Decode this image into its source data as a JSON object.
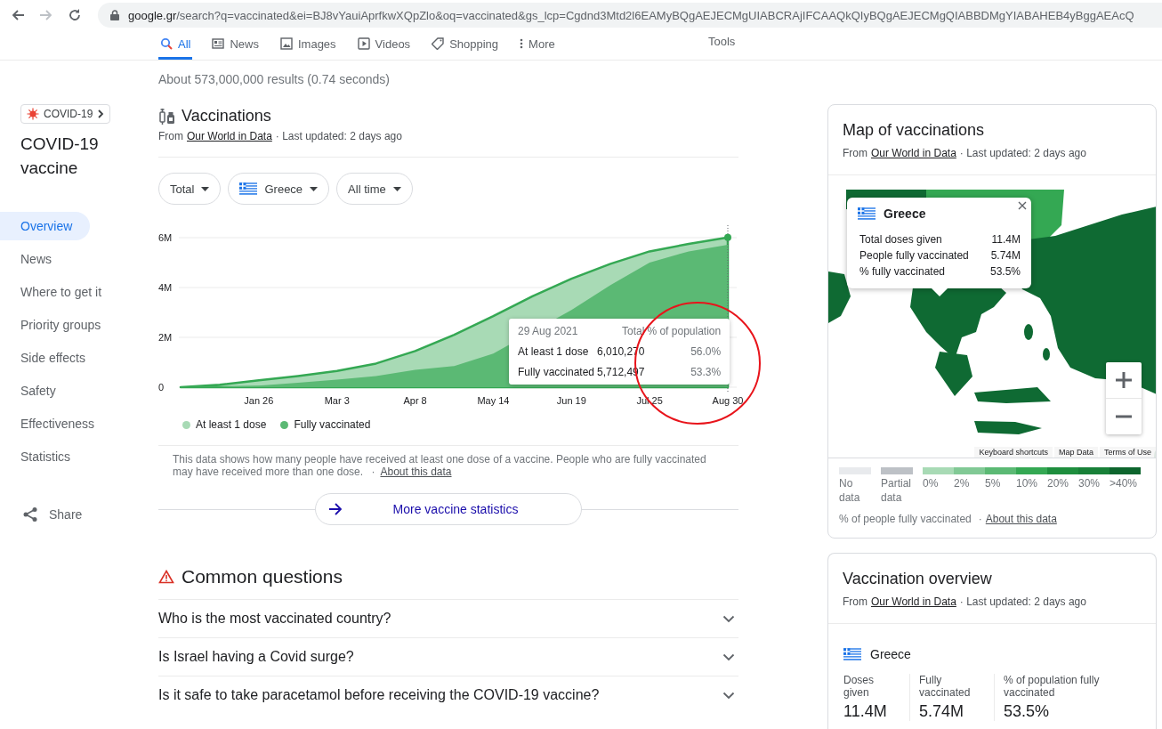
{
  "browser": {
    "nav_buttons": [
      {
        "kind": "back",
        "disabled": false
      },
      {
        "kind": "forward",
        "disabled": true
      },
      {
        "kind": "reload",
        "disabled": false
      }
    ],
    "url_host": "google.gr",
    "url_path": "/search?q=vaccinated&ei=BJ8vYauiAprfkwXQpZlo&oq=vaccinated&gs_lcp=Cgdnd3Mtd2l6EAMyBQgAEJECMgUIABCRAjIFCAAQkQIyBQgAEJECMgQIABBDMgYIABAHEB4yBggAEAcQ"
  },
  "search_tabs": [
    {
      "label": "All",
      "kind": "search",
      "selected": true
    },
    {
      "label": "News",
      "kind": "news",
      "selected": false
    },
    {
      "label": "Images",
      "kind": "images",
      "selected": false
    },
    {
      "label": "Videos",
      "kind": "videos",
      "selected": false
    },
    {
      "label": "Shopping",
      "kind": "shopping",
      "selected": false
    },
    {
      "label": "More",
      "kind": "more",
      "selected": false
    }
  ],
  "tools_label": "Tools",
  "result_stats": "About 573,000,000 results (0.74 seconds)",
  "topic": {
    "chip": "COVID-19",
    "title": "COVID-19 vaccine"
  },
  "sidebar": {
    "items": [
      {
        "label": "Overview",
        "selected": true
      },
      {
        "label": "News",
        "selected": false
      },
      {
        "label": "Where to get it",
        "selected": false
      },
      {
        "label": "Priority groups",
        "selected": false
      },
      {
        "label": "Side effects",
        "selected": false
      },
      {
        "label": "Safety",
        "selected": false
      },
      {
        "label": "Effectiveness",
        "selected": false
      },
      {
        "label": "Statistics",
        "selected": false
      }
    ],
    "share": "Share"
  },
  "vaccinations": {
    "title": "Vaccinations",
    "source": {
      "prefix": "From",
      "link": "Our World in Data",
      "suffix": "· Last updated: 2 days ago"
    },
    "filters": [
      {
        "label": "Total",
        "kind": "plain"
      },
      {
        "label": "Greece",
        "kind": "flag"
      },
      {
        "label": "All time",
        "kind": "plain"
      }
    ],
    "chart_data": {
      "type": "area",
      "categories": [
        null,
        null,
        "Jan 26",
        null,
        "Mar 3",
        null,
        "Apr 8",
        null,
        "May 14",
        null,
        "Jun 19",
        null,
        "Jul 25",
        null,
        "Aug 30"
      ],
      "series": [
        {
          "name": "At least 1 dose",
          "color": "#a8dab5",
          "values": [
            0,
            0.1,
            0.28,
            0.45,
            0.65,
            0.95,
            1.45,
            2.1,
            2.85,
            3.65,
            4.35,
            4.95,
            5.45,
            5.75,
            6.01
          ]
        },
        {
          "name": "Fully vaccinated",
          "color": "#5bb974",
          "values": [
            0,
            0.02,
            0.06,
            0.18,
            0.3,
            0.45,
            0.7,
            0.85,
            1.35,
            null,
            3.1,
            4.1,
            5.0,
            5.45,
            5.71
          ]
        }
      ],
      "grid": true,
      "ylim": [
        0,
        6.5
      ],
      "yticks": [
        {
          "value": 0,
          "label": "0"
        },
        {
          "value": 2,
          "label": "2M"
        },
        {
          "value": 4,
          "label": "4M"
        },
        {
          "value": 6,
          "label": "6M"
        }
      ]
    },
    "tooltip": {
      "date": "29 Aug 2021",
      "columns": [
        "Total",
        "% of population"
      ],
      "rows": [
        {
          "label": "At least 1 dose",
          "total": "6,010,270",
          "percent": "56.0%"
        },
        {
          "label": "Fully vaccinated",
          "total": "5,712,497",
          "percent": "53.3%"
        }
      ]
    },
    "note": {
      "text": "This data shows how many people have received at least one dose of a vaccine. People who are fully vaccinated may have received more than one dose.",
      "sep": "·",
      "link": "About this data"
    },
    "more_button": "More vaccine statistics"
  },
  "common_questions": {
    "title": "Common questions",
    "items": [
      {
        "question": "Who is the most vaccinated country?",
        "expanded": false
      },
      {
        "question": "Is Israel having a Covid surge?",
        "expanded": false
      },
      {
        "question": "Is it safe to take paracetamol before receiving the COVID-19 vaccine?",
        "expanded": false
      }
    ]
  },
  "map_card": {
    "title": "Map of vaccinations",
    "source": {
      "prefix": "From",
      "link": "Our World in Data",
      "suffix": "· Last updated: 2 days ago"
    },
    "map": {
      "kind": "picture"
    },
    "tooltip": {
      "country": "Greece",
      "rows": [
        {
          "label": "Total doses given",
          "value": "11.4M"
        },
        {
          "label": "People fully vaccinated",
          "value": "5.74M"
        },
        {
          "label": "% fully vaccinated",
          "value": "53.5%"
        }
      ]
    },
    "map_footer": [
      "Keyboard shortcuts",
      "Map Data",
      "Terms of Use"
    ],
    "legend": [
      {
        "label": "No data",
        "color": "#e8eaed"
      },
      {
        "label": "Partial data",
        "color": "#bdc1c6"
      },
      {
        "label": "0%",
        "color": "#a8dab5"
      },
      {
        "label": "2%",
        "color": "#81c995"
      },
      {
        "label": "5%",
        "color": "#5bb974"
      },
      {
        "label": "10%",
        "color": "#34a853"
      },
      {
        "label": "20%",
        "color": "#1e8e3e"
      },
      {
        "label": "30%",
        "color": "#188038"
      },
      {
        "label": ">40%",
        "color": "#0d652d"
      }
    ],
    "legend_caption": "% of people fully vaccinated",
    "legend_sep": "·",
    "legend_link": "About this data"
  },
  "overview_card": {
    "title": "Vaccination overview",
    "source": {
      "prefix": "From",
      "link": "Our World in Data",
      "suffix": "· Last updated: 2 days ago"
    },
    "country": "Greece",
    "stats": [
      {
        "label": "Doses given",
        "value": "11.4M"
      },
      {
        "label": "Fully vaccinated",
        "value": "5.74M"
      },
      {
        "label": "% of population fully vaccinated",
        "value": "53.5%"
      }
    ]
  }
}
